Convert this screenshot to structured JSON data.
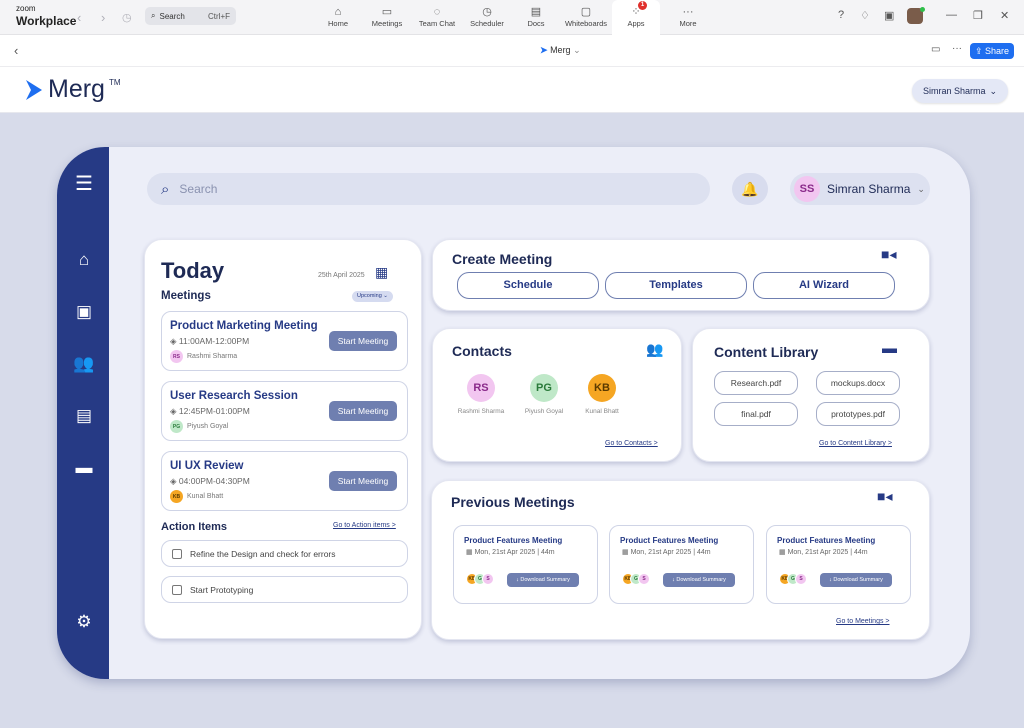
{
  "zoom": {
    "brand_small": "zoom",
    "brand": "Workplace",
    "search": "Search",
    "shortcut": "Ctrl+F",
    "nav": [
      {
        "label": "Home",
        "icon": "⌂"
      },
      {
        "label": "Meetings",
        "icon": "▭"
      },
      {
        "label": "Team Chat",
        "icon": "◌"
      },
      {
        "label": "Scheduler",
        "icon": "◷"
      },
      {
        "label": "Docs",
        "icon": "▤"
      },
      {
        "label": "Whiteboards",
        "icon": "▢"
      },
      {
        "label": "Apps",
        "icon": "⁘"
      },
      {
        "label": "More",
        "icon": "···"
      }
    ],
    "apps_badge": "1"
  },
  "tab": {
    "title": "Merg",
    "share": "Share"
  },
  "header": {
    "logo": "Merg",
    "tm": "TM",
    "user": "Simran Sharma"
  },
  "app": {
    "search_placeholder": "Search",
    "profile_initials": "SS",
    "profile_name": "Simran Sharma"
  },
  "today": {
    "title": "Today",
    "date": "25th April 2025",
    "section": "Meetings",
    "filter": "Upcoming",
    "meetings": [
      {
        "title": "Product Marketing Meeting",
        "time": "11:00AM-12:00PM",
        "initials": "RS",
        "person": "Rashmi Sharma",
        "btn": "Start Meeting"
      },
      {
        "title": "User Research Session",
        "time": "12:45PM-01:00PM",
        "initials": "PG",
        "person": "Piyush Goyal",
        "btn": "Start Meeting"
      },
      {
        "title": "UI UX Review",
        "time": "04:00PM-04:30PM",
        "initials": "KB",
        "person": "Kunal Bhatt",
        "btn": "Start Meeting"
      }
    ],
    "actions_title": "Action Items",
    "actions_link": "Go to Action items  >",
    "actions": [
      "Refine the Design and check for errors",
      "Start Prototyping"
    ]
  },
  "create": {
    "title": "Create Meeting",
    "buttons": [
      "Schedule",
      "Templates",
      "AI Wizard"
    ]
  },
  "contacts": {
    "title": "Contacts",
    "people": [
      {
        "initials": "RS",
        "name": "Rashmi Sharma"
      },
      {
        "initials": "PG",
        "name": "Piyush Goyal"
      },
      {
        "initials": "KB",
        "name": "Kunal Bhatt"
      }
    ],
    "link": "Go to Contacts  >"
  },
  "library": {
    "title": "Content Library",
    "files": [
      "Research.pdf",
      "mockups.docx",
      "final.pdf",
      "prototypes.pdf"
    ],
    "link": "Go to Content Library  >"
  },
  "previous": {
    "title": "Previous Meetings",
    "link": "Go to Meetings  >",
    "meetings": [
      {
        "title": "Product Features Meeting",
        "date": "Mon, 21st Apr 2025 | 44m",
        "btn": "Download Summary"
      },
      {
        "title": "Product Features Meeting",
        "date": "Mon, 21st Apr 2025 | 44m",
        "btn": "Download Summary"
      },
      {
        "title": "Product Features Meeting",
        "date": "Mon, 21st Apr 2025 | 44m",
        "btn": "Download Summary"
      }
    ],
    "avatars": [
      "KB",
      "G",
      "S"
    ]
  },
  "colors": {
    "primary": "#263a85",
    "accent": "#6f7fb0",
    "rs": "#f2c6f0",
    "pg": "#bfe8c8",
    "kb": "#f5a623"
  }
}
